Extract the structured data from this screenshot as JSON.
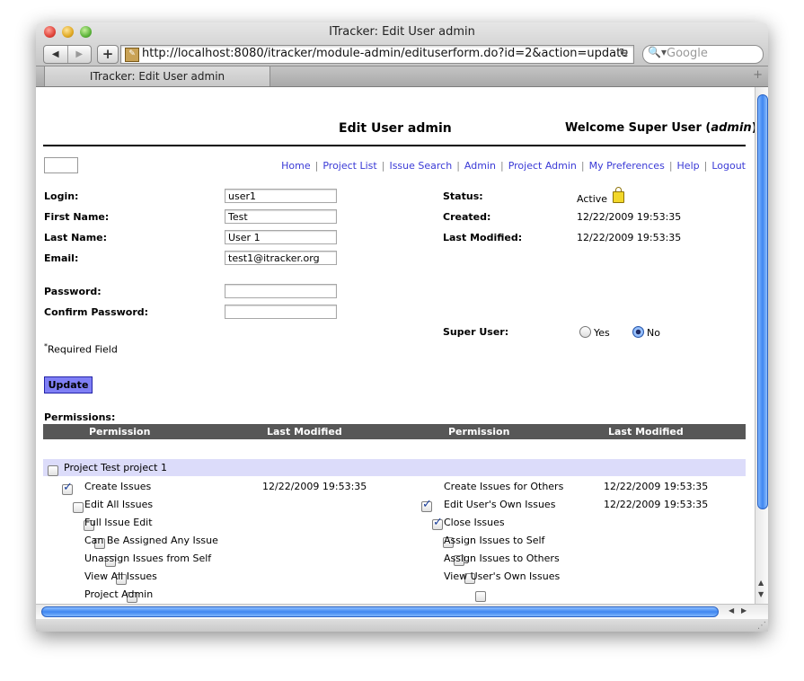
{
  "window": {
    "title": "ITracker: Edit User admin",
    "url": "http://localhost:8080/itracker/module-admin/edituserform.do?id=2&action=update",
    "search_placeholder": "Google",
    "tab_title": "ITracker: Edit User admin"
  },
  "page": {
    "title": "Edit User admin",
    "welcome_prefix": "Welcome Super User (",
    "welcome_user": "admin",
    "welcome_suffix": ")"
  },
  "nav": {
    "links": [
      "Home",
      "Project List",
      "Issue Search",
      "Admin",
      "Project Admin",
      "My Preferences",
      "Help",
      "Logout"
    ],
    "separator": "|"
  },
  "form": {
    "login_label": "Login:",
    "login_value": "user1",
    "first_name_label": "First Name:",
    "first_name_value": "Test",
    "last_name_label": "Last Name:",
    "last_name_value": "User 1",
    "email_label": "Email:",
    "email_value": "test1@itracker.org",
    "password_label": "Password:",
    "password_value": "",
    "confirm_password_label": "Confirm Password:",
    "confirm_password_value": "",
    "required_marker": "*",
    "required_note": "Required Field",
    "update_label": "Update"
  },
  "info": {
    "status_label": "Status:",
    "status_value": "Active",
    "created_label": "Created:",
    "created_value": "12/22/2009 19:53:35",
    "last_modified_label": "Last Modified:",
    "last_modified_value": "12/22/2009 19:53:35",
    "super_user_label": "Super User:",
    "super_user_yes": "Yes",
    "super_user_no": "No",
    "super_user_selected": "No"
  },
  "permissions": {
    "section_label": "Permissions:",
    "headers": [
      "Permission",
      "Last Modified",
      "Permission",
      "Last Modified"
    ],
    "project_label": "Project Test project 1",
    "project_checked": false,
    "left": [
      {
        "label": "Create Issues",
        "checked": true,
        "modified": "12/22/2009 19:53:35"
      },
      {
        "label": "Edit All Issues",
        "checked": false,
        "modified": ""
      },
      {
        "label": "Full Issue Edit",
        "checked": false,
        "modified": ""
      },
      {
        "label": "Can Be Assigned Any Issue",
        "checked": false,
        "modified": ""
      },
      {
        "label": "Unassign Issues from Self",
        "checked": false,
        "modified": ""
      },
      {
        "label": "View All Issues",
        "checked": false,
        "modified": ""
      },
      {
        "label": "Project Admin",
        "checked": false,
        "modified": ""
      }
    ],
    "right": [
      {
        "label": "Create Issues for Others",
        "checked": true,
        "modified": "12/22/2009 19:53:35"
      },
      {
        "label": "Edit User's Own Issues",
        "checked": true,
        "modified": "12/22/2009 19:53:35"
      },
      {
        "label": "Close Issues",
        "checked": false,
        "modified": ""
      },
      {
        "label": "Assign Issues to Self",
        "checked": false,
        "modified": ""
      },
      {
        "label": "Assign Issues to Others",
        "checked": false,
        "modified": ""
      },
      {
        "label": "View User's Own Issues",
        "checked": false,
        "modified": ""
      }
    ]
  },
  "colors": {
    "link": "#3a3ad6",
    "header_bar": "#575757",
    "project_row": "#dcdcfa",
    "update_button": "#7f7ff5"
  }
}
